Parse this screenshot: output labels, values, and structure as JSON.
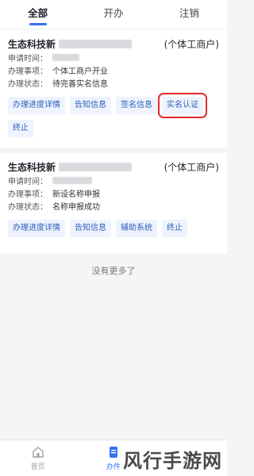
{
  "tabs": [
    {
      "label": "全部",
      "active": true
    },
    {
      "label": "开办",
      "active": false
    },
    {
      "label": "注销",
      "active": false
    }
  ],
  "cards": [
    {
      "name_prefix": "生态科技新",
      "type": "(个体工商户)",
      "apply_time_label": "申请时间：",
      "item_label": "办理事项：",
      "item_value": "个体工商户开业",
      "status_label": "办理状态：",
      "status_value": "待完善实名信息",
      "buttons": [
        "办理进度详情",
        "告知信息",
        "签名信息",
        "实名认证",
        "终止"
      ],
      "highlighted_button": "实名认证"
    },
    {
      "name_prefix": "生态科技新",
      "type": "(个体工商户)",
      "apply_time_label": "申请时间：",
      "item_label": "办理事项：",
      "item_value": "新设名称申报",
      "status_label": "办理状态：",
      "status_value": "名称申报成功",
      "buttons": [
        "办理进度详情",
        "告知信息",
        "辅助系统",
        "终止"
      ]
    }
  ],
  "no_more_text": "没有更多了",
  "bottom_nav": [
    {
      "label": "首页",
      "icon": "home-icon",
      "active": false
    },
    {
      "label": "办件",
      "icon": "document-icon",
      "active": true
    },
    {
      "label": "",
      "icon": "user-icon",
      "active": false
    }
  ],
  "watermark": "风行手游网",
  "colors": {
    "accent": "#3471f5",
    "highlight": "#e32828",
    "button_bg": "#eef3fd",
    "button_text": "#2f5fb8"
  }
}
